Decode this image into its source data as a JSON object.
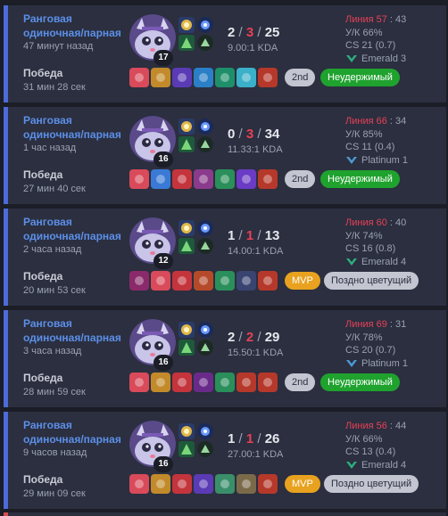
{
  "matches": [
    {
      "queue": "Ранговая одиночная/парная",
      "ago": "47 минут назад",
      "result": "Победа",
      "duration": "31 мин 28 сек",
      "level": "17",
      "kills": "2",
      "deaths": "3",
      "assists": "25",
      "ratio": "9.00:1 KDA",
      "lane_label": "Линия 57",
      "lane_rest": " : 43",
      "ka": "У/К 66%",
      "cs": "CS 21 (0.7)",
      "rank": "Emerald 3",
      "rank_color": "#2daf7f",
      "badge1": "2nd",
      "badge1_type": "place",
      "badge2": "Неудержимый",
      "badge2_type": "green"
    },
    {
      "queue": "Ранговая одиночная/парная",
      "ago": "1 час назад",
      "result": "Победа",
      "duration": "27 мин 40 сек",
      "level": "16",
      "kills": "0",
      "deaths": "3",
      "assists": "34",
      "ratio": "11.33:1 KDA",
      "lane_label": "Линия 66",
      "lane_rest": " : 34",
      "ka": "У/К 85%",
      "cs": "CS 11 (0.4)",
      "rank": "Platinum 1",
      "rank_color": "#4e99d3",
      "badge1": "2nd",
      "badge1_type": "place",
      "badge2": "Неудержимый",
      "badge2_type": "green"
    },
    {
      "queue": "Ранговая одиночная/парная",
      "ago": "2 часа назад",
      "result": "Победа",
      "duration": "20 мин 53 сек",
      "level": "12",
      "kills": "1",
      "deaths": "1",
      "assists": "13",
      "ratio": "14.00:1 KDA",
      "lane_label": "Линия 60",
      "lane_rest": " : 40",
      "ka": "У/К 74%",
      "cs": "CS 16 (0.8)",
      "rank": "Emerald 4",
      "rank_color": "#2daf7f",
      "badge1": "MVP",
      "badge1_type": "mvp",
      "badge2": "Поздно цветущий",
      "badge2_type": "grey"
    },
    {
      "queue": "Ранговая одиночная/парная",
      "ago": "3 часа назад",
      "result": "Победа",
      "duration": "28 мин 59 сек",
      "level": "16",
      "kills": "2",
      "deaths": "2",
      "assists": "29",
      "ratio": "15.50:1 KDA",
      "lane_label": "Линия 69",
      "lane_rest": " : 31",
      "ka": "У/К 78%",
      "cs": "CS 20 (0.7)",
      "rank": "Platinum 1",
      "rank_color": "#4e99d3",
      "badge1": "2nd",
      "badge1_type": "place",
      "badge2": "Неудержимый",
      "badge2_type": "green"
    },
    {
      "queue": "Ранговая одиночная/парная",
      "ago": "9 часов назад",
      "result": "Победа",
      "duration": "29 мин 09 сек",
      "level": "16",
      "kills": "1",
      "deaths": "1",
      "assists": "26",
      "ratio": "27.00:1 KDA",
      "lane_label": "Линия 56",
      "lane_rest": " : 44",
      "ka": "У/К 66%",
      "cs": "CS 13 (0.4)",
      "rank": "Emerald 4",
      "rank_color": "#2daf7f",
      "badge1": "MVP",
      "badge1_type": "mvp",
      "badge2": "Поздно цветущий",
      "badge2_type": "grey"
    }
  ],
  "item_colors": [
    [
      "#d94a5a",
      "#c28a2a",
      "#5a3bb5",
      "#2a7fc6",
      "#1e8f6a",
      "#3ab0c9",
      "#b5382a"
    ],
    [
      "#d94a5a",
      "#3a7ad6",
      "#c4343c",
      "#8a3b8c",
      "#2a8f5a",
      "#6a3bc4",
      "#b5382a"
    ],
    [
      "#8a2a6a",
      "#d94a5a",
      "#c4343c",
      "#b54a2a",
      "#2a8f5a",
      "#3a4470",
      "#b5382a"
    ],
    [
      "#d94a5a",
      "#c28a2a",
      "#c4343c",
      "#6a2a8a",
      "#2a8f5a",
      "#b5382a",
      "#b5382a"
    ],
    [
      "#d94a5a",
      "#c28a2a",
      "#c4343c",
      "#5a3bb5",
      "#3a8f6a",
      "#7a6a4a",
      "#b5382a"
    ]
  ]
}
